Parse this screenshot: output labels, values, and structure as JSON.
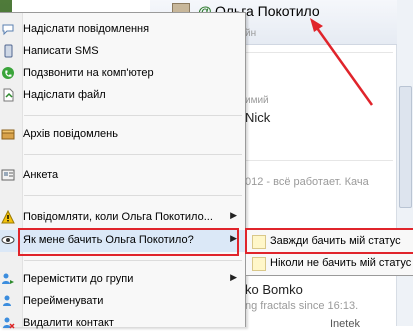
{
  "contact": {
    "name": "Ольга Покотило",
    "status_fragment": "йн"
  },
  "background_fragments": {
    "mid_status": "имий",
    "nick": "Nick",
    "status_line": "012 - всё работает. Кача",
    "other_name": "ko Bomko",
    "other_status": "ng fractals since 16:13.",
    "bottom": "Inetek"
  },
  "menu": {
    "items": [
      {
        "label": "Надіслати повідомлення",
        "icon": "message-icon"
      },
      {
        "label": "Написати SMS",
        "icon": "sms-icon"
      },
      {
        "label": "Подзвонити на комп'ютер",
        "icon": "phone-icon"
      },
      {
        "label": "Надіслати файл",
        "icon": "file-icon"
      },
      {
        "label": "Архів повідомлень",
        "icon": "archive-icon"
      },
      {
        "label": "Анкета",
        "icon": "profile-icon"
      },
      {
        "label": "Повідомляти, коли Ольга Покотило...",
        "icon": "alert-icon"
      },
      {
        "label": "Як мене бачить Ольга Покотило?",
        "icon": "eye-icon"
      },
      {
        "label": "Перемістити до групи",
        "icon": "group-move-icon"
      },
      {
        "label": "Перейменувати",
        "icon": "rename-icon"
      },
      {
        "label": "Видалити контакт",
        "icon": "delete-icon"
      }
    ]
  },
  "submenu": {
    "items": [
      {
        "label": "Завжди бачить мій статус"
      },
      {
        "label": "Ніколи не бачить мій статус"
      }
    ]
  },
  "colors": {
    "highlight_box": "#e0242b",
    "hover": "#dbe8f7"
  }
}
